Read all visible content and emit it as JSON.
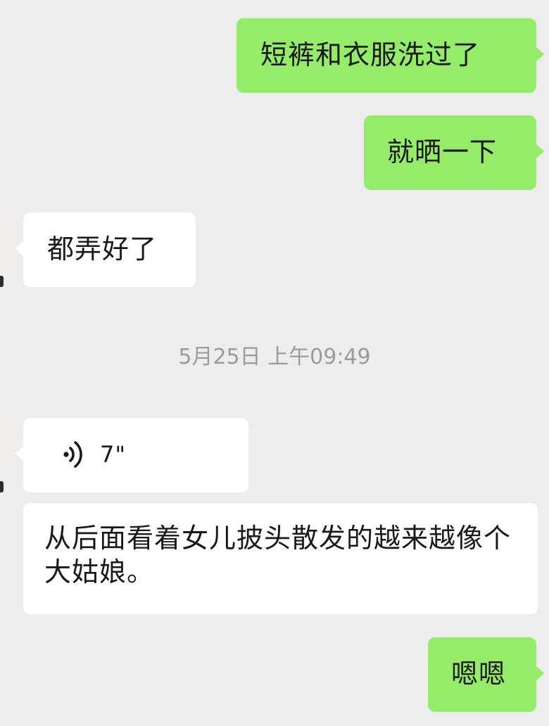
{
  "messages": [
    {
      "id": "m1",
      "direction": "out",
      "type": "text",
      "text": "短裤和衣服洗过了"
    },
    {
      "id": "m2",
      "direction": "out",
      "type": "text",
      "text": "就晒一下"
    },
    {
      "id": "m3",
      "direction": "in",
      "type": "text",
      "text": "都弄好了"
    },
    {
      "id": "m4",
      "direction": "in",
      "type": "voice",
      "icon": "voice-wave-icon",
      "duration": "7\""
    },
    {
      "id": "m5",
      "direction": "in",
      "type": "text",
      "text": "从后面看着女儿披头散发的越来越像个大姑娘。"
    },
    {
      "id": "m6",
      "direction": "out",
      "type": "text",
      "text": "嗯嗯"
    }
  ],
  "timestamp": "5月25日 上午09:49",
  "colors": {
    "background": "#ededed",
    "outgoing_bubble": "#95ec69",
    "incoming_bubble": "#ffffff",
    "timestamp_text": "#9b9b9b"
  }
}
